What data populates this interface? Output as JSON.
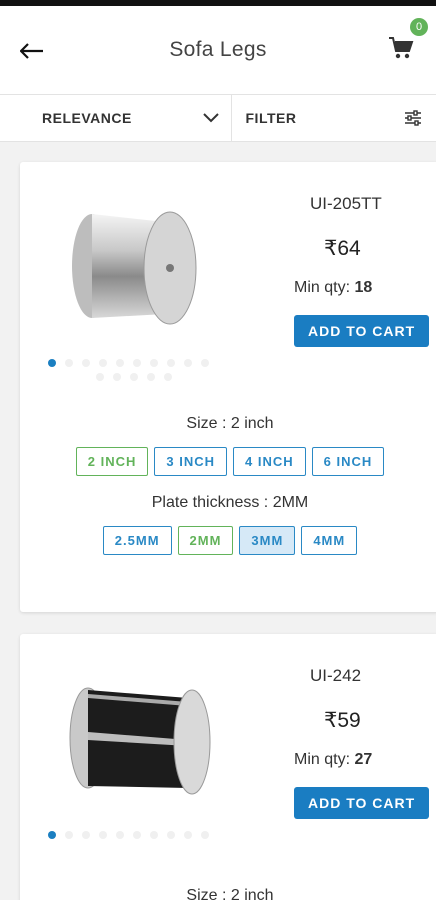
{
  "header": {
    "title": "Sofa Legs",
    "back_icon": "arrow-left-icon",
    "cart_icon": "cart-icon",
    "cart_count": "0"
  },
  "sortbar": {
    "sort_label": "RELEVANCE",
    "filter_label": "FILTER"
  },
  "products": [
    {
      "code": "UI-205TT",
      "price": "₹64",
      "min_qty_label": "Min qty: ",
      "min_qty": "18",
      "add_label": "ADD TO CART",
      "size_label": "Size : 2 inch",
      "sizes": [
        "2 INCH",
        "3 INCH",
        "4 INCH",
        "6 INCH"
      ],
      "thickness_label": "Plate thickness : 2MM",
      "thicknesses": [
        "2.5MM",
        "2MM",
        "3MM",
        "4MM"
      ]
    },
    {
      "code": "UI-242",
      "price": "₹59",
      "min_qty_label": "Min qty: ",
      "min_qty": "27",
      "add_label": "ADD TO CART",
      "size_label": "Size : 2 inch"
    }
  ],
  "colors": {
    "accent": "#1a7dc2",
    "selected": "#62b35a"
  }
}
